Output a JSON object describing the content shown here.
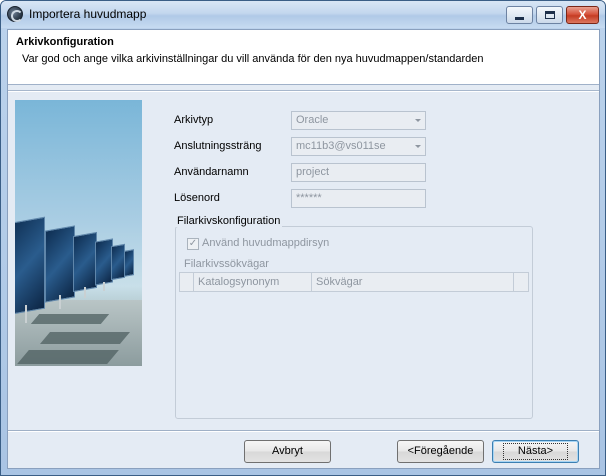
{
  "window": {
    "title": "Importera huvudmapp",
    "controls": {
      "minimize": "minimize",
      "maximize": "maximize",
      "close": "X"
    }
  },
  "header": {
    "title": "Arkivkonfiguration",
    "description": "Var god och ange vilka arkivinställningar du vill använda för den nya huvudmappen/standarden"
  },
  "form": {
    "archive_type": {
      "label": "Arkivtyp",
      "value": "Oracle"
    },
    "connection_string": {
      "label": "Anslutningssträng",
      "value": "mc11b3@vs011se"
    },
    "username": {
      "label": "Användarnamn",
      "value": "project"
    },
    "password": {
      "label": "Lösenord",
      "value": "******"
    }
  },
  "file_archive": {
    "group_title": "Filarkivskonfiguration",
    "use_root_dir": {
      "label": "Använd huvudmappdirsyn",
      "checked": true
    },
    "paths_label": "Filarkivssökvägar",
    "columns": [
      "Katalogsynonym",
      "Sökvägar"
    ],
    "rows": []
  },
  "buttons": {
    "cancel": "Avbryt",
    "previous": "<Föregående",
    "next": "Nästa>"
  },
  "colors": {
    "title_bar": "#c3d7ee",
    "client_bg": "#e4ebf4",
    "close_button": "#c53c23",
    "disabled_text": "#8e96a0"
  }
}
